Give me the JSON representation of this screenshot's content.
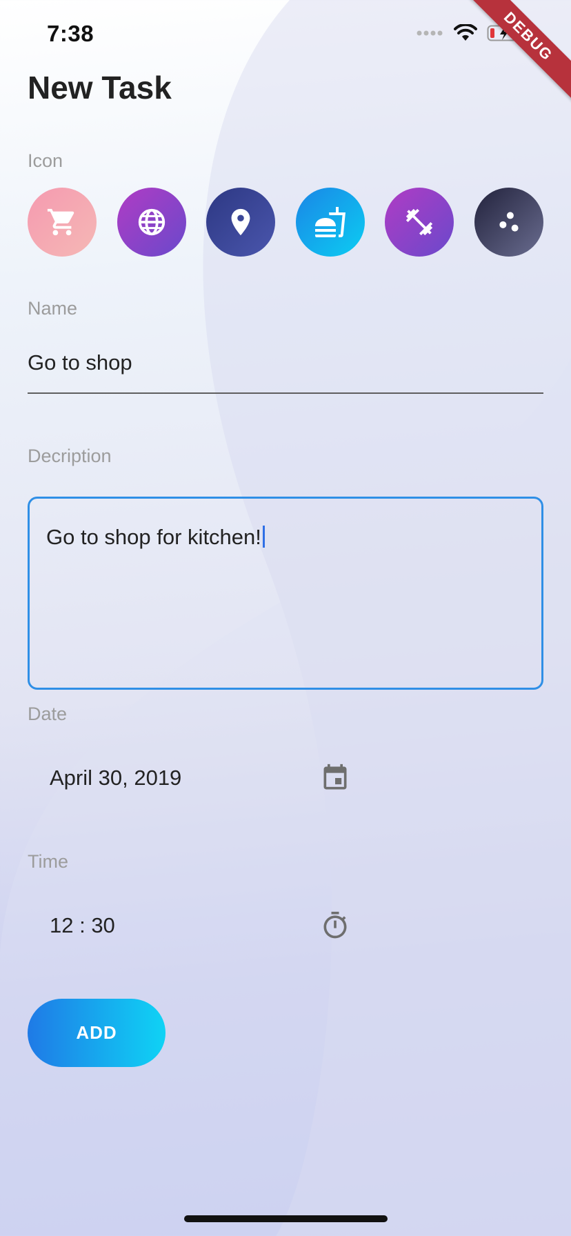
{
  "status_bar": {
    "time": "7:38",
    "icons": [
      "cellular-dots-icon",
      "wifi-icon",
      "battery-charging-icon"
    ]
  },
  "debug_banner": "DEBUG",
  "page": {
    "title": "New Task"
  },
  "icon_picker": {
    "label": "Icon",
    "options": [
      {
        "name": "cart-icon",
        "gradient": [
          "#f59ab0",
          "#f5b8b5"
        ]
      },
      {
        "name": "globe-icon",
        "gradient": [
          "#a03bc6",
          "#6d48c9"
        ]
      },
      {
        "name": "location-pin-icon",
        "gradient": [
          "#2f3c8a",
          "#4451a8"
        ]
      },
      {
        "name": "fast-food-icon",
        "gradient": [
          "#1a8ee8",
          "#0cc6f0"
        ]
      },
      {
        "name": "fitness-icon",
        "gradient": [
          "#a83fc6",
          "#7248c6"
        ]
      },
      {
        "name": "scatter-dots-icon",
        "gradient": [
          "#2a2a44",
          "#63668a"
        ]
      }
    ]
  },
  "name_field": {
    "label": "Name",
    "value": "Go to shop"
  },
  "description_field": {
    "label": "Decription",
    "value": "Go to shop for kitchen!"
  },
  "date_field": {
    "label": "Date",
    "value": "April 30, 2019"
  },
  "time_field": {
    "label": "Time",
    "value": "12 : 30"
  },
  "add_button": {
    "label": "ADD"
  },
  "colors": {
    "accent": "#2f8fe6",
    "button_start": "#1f7ae6",
    "button_end": "#0fd3f5",
    "debug_ribbon": "#b7323c"
  }
}
